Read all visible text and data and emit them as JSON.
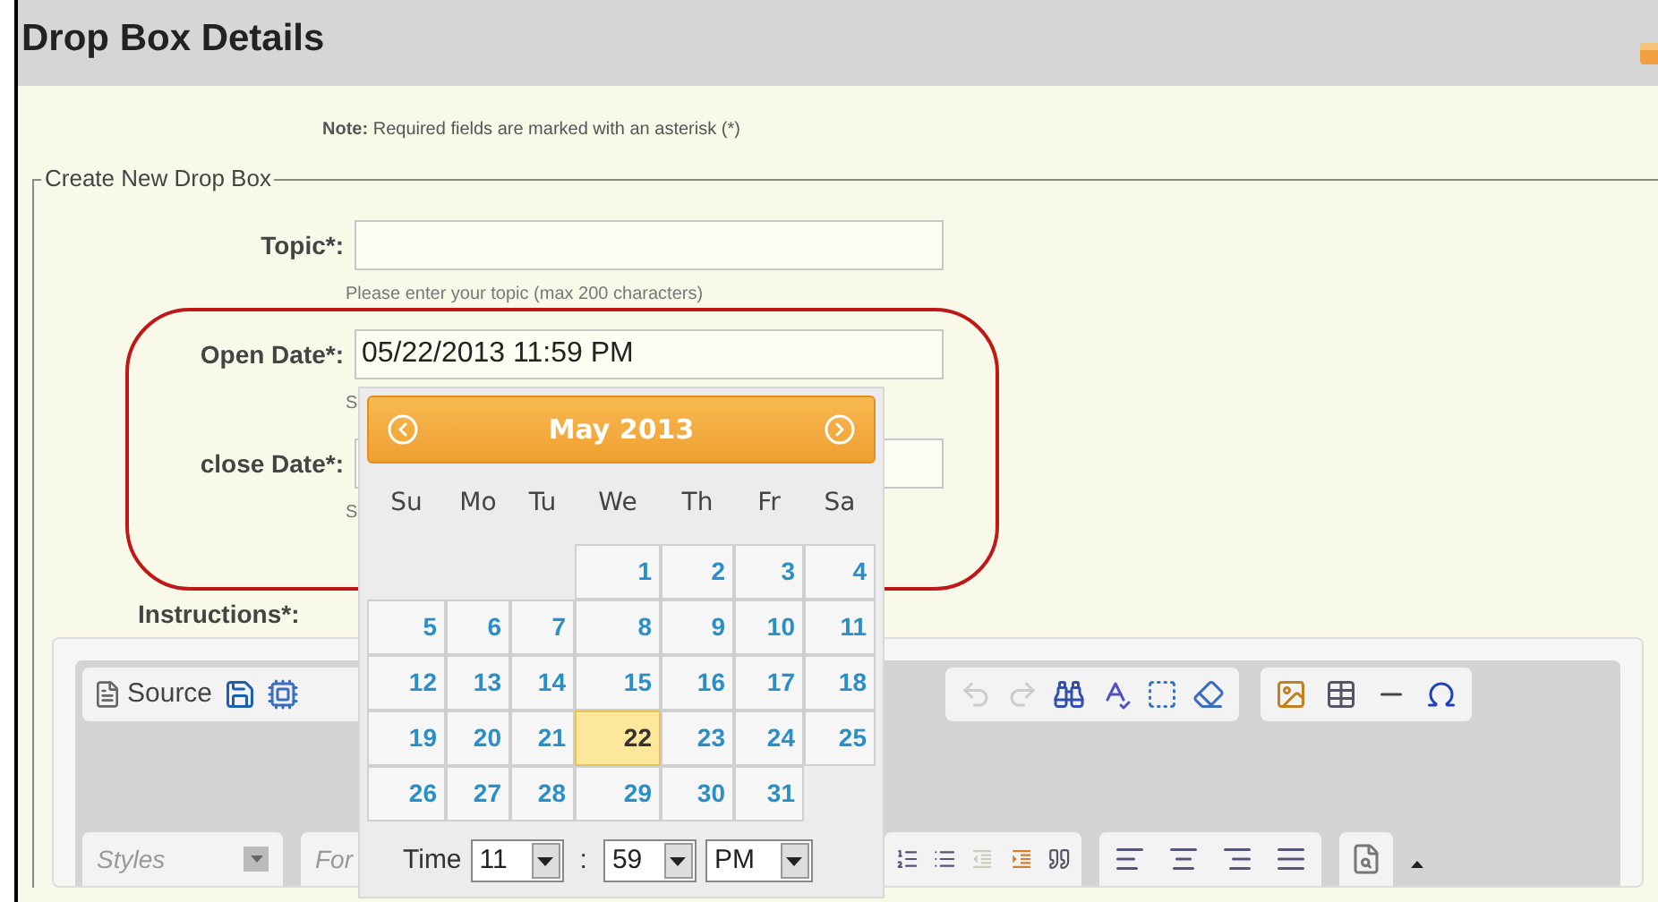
{
  "header": {
    "title": "Drop Box Details"
  },
  "note": {
    "label": "Note:",
    "text": "Required fields are marked with an asterisk (*)"
  },
  "form": {
    "legend": "Create New Drop Box",
    "fields": [
      {
        "label": "Topic*:",
        "hint": "Please enter your topic (max 200 characters)"
      },
      {
        "label": "Open Date*:",
        "value": "05/22/2013 11:59 PM",
        "hint": "S"
      },
      {
        "label": "close Date*:",
        "hint": "S"
      }
    ],
    "instructions_label": "Instructions*:"
  },
  "editor": {
    "source_label": "Source",
    "styles_placeholder": "Styles",
    "format_placeholder": "For"
  },
  "calendar": {
    "month": "May 2013",
    "weekdays": [
      "Su",
      "Mo",
      "Tu",
      "We",
      "Th",
      "Fr",
      "Sa"
    ],
    "weeks": [
      [
        {
          "kind": "empty"
        },
        {
          "kind": "empty"
        },
        {
          "kind": "empty"
        },
        {
          "day": "1",
          "selected": false
        },
        {
          "day": "2",
          "selected": false
        },
        {
          "day": "3",
          "selected": false
        },
        {
          "day": "4",
          "selected": false
        }
      ],
      [
        {
          "day": "5",
          "selected": false
        },
        {
          "day": "6",
          "selected": false
        },
        {
          "day": "7",
          "selected": false
        },
        {
          "day": "8",
          "selected": false
        },
        {
          "day": "9",
          "selected": false
        },
        {
          "day": "10",
          "selected": false
        },
        {
          "day": "11",
          "selected": false
        }
      ],
      [
        {
          "day": "12",
          "selected": false
        },
        {
          "day": "13",
          "selected": false
        },
        {
          "day": "14",
          "selected": false
        },
        {
          "day": "15",
          "selected": false
        },
        {
          "day": "16",
          "selected": false
        },
        {
          "day": "17",
          "selected": false
        },
        {
          "day": "18",
          "selected": false
        }
      ],
      [
        {
          "day": "19",
          "selected": false
        },
        {
          "day": "20",
          "selected": false
        },
        {
          "day": "21",
          "selected": false
        },
        {
          "day": "22",
          "selected": true
        },
        {
          "day": "23",
          "selected": false
        },
        {
          "day": "24",
          "selected": false
        },
        {
          "day": "25",
          "selected": false
        }
      ],
      [
        {
          "day": "26",
          "selected": false
        },
        {
          "day": "27",
          "selected": false
        },
        {
          "day": "28",
          "selected": false
        },
        {
          "day": "29",
          "selected": false
        },
        {
          "day": "30",
          "selected": false
        },
        {
          "day": "31",
          "selected": false
        },
        {
          "kind": "empty"
        }
      ]
    ],
    "time_label": "Time",
    "hour": "11",
    "separator": ":",
    "minute": "59",
    "ampm": "PM"
  }
}
